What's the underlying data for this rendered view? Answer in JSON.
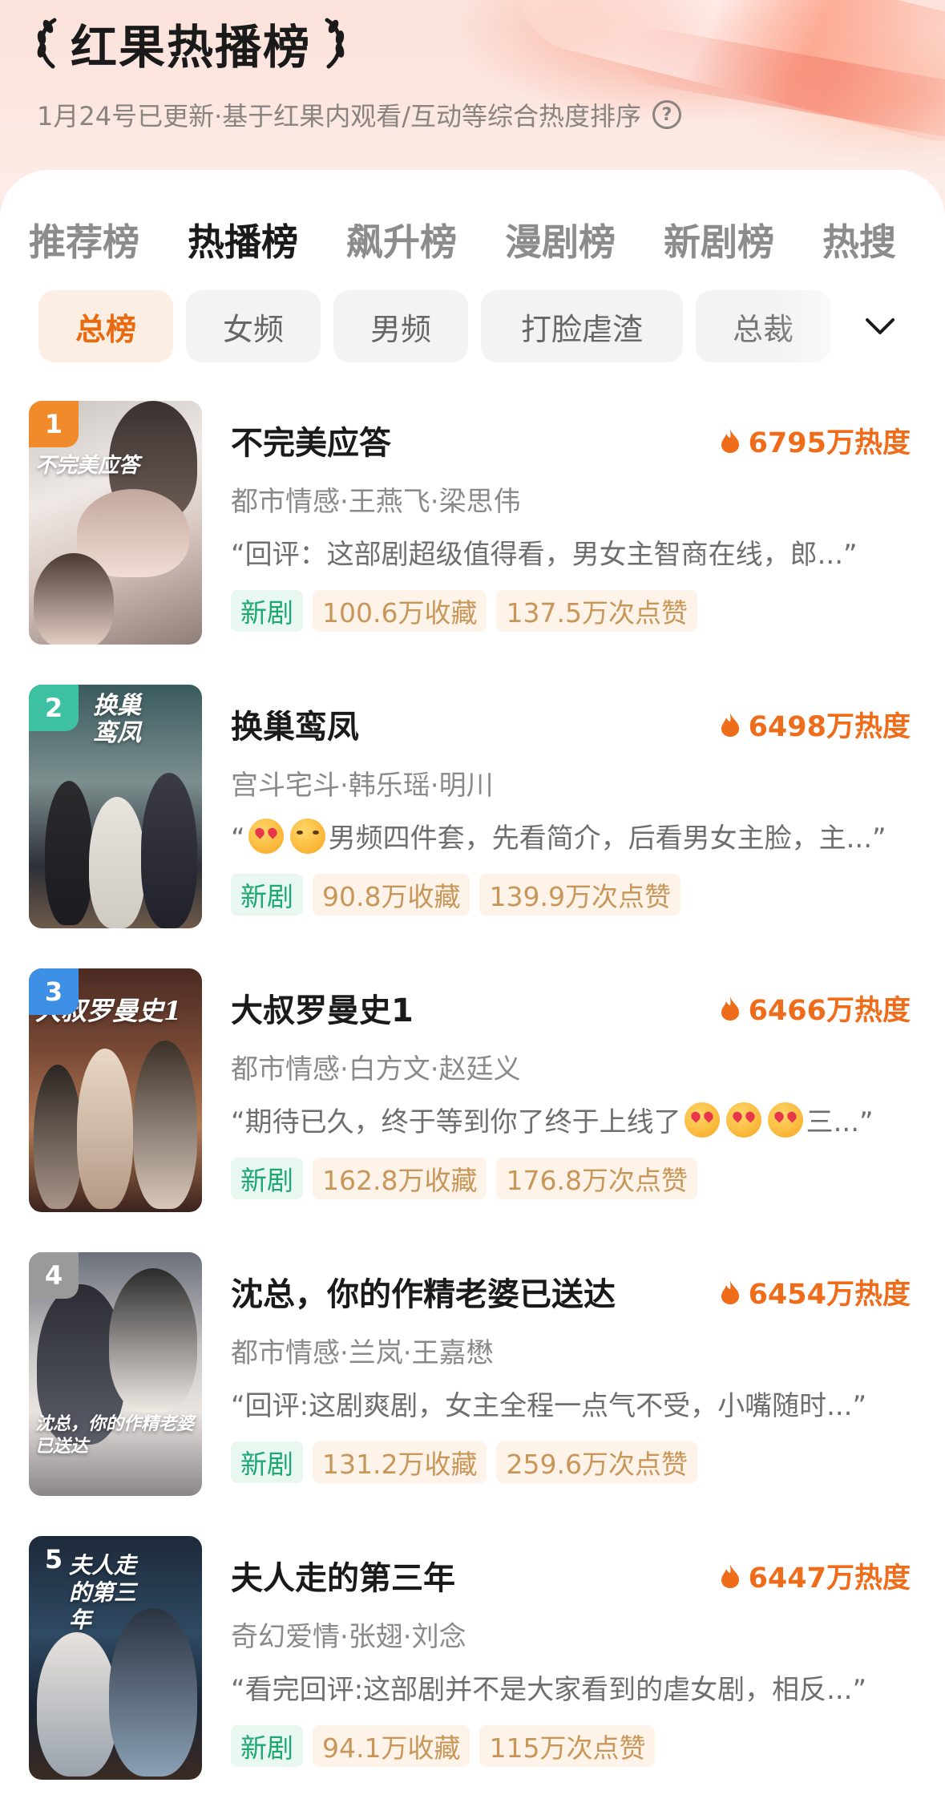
{
  "header": {
    "title": "红果热播榜",
    "subtitle": "1月24号已更新·基于红果内观看/互动等综合热度排序"
  },
  "tabs": [
    "推荐榜",
    "热播榜",
    "飙升榜",
    "漫剧榜",
    "新剧榜",
    "热搜"
  ],
  "active_tab": "热播榜",
  "chips": [
    "总榜",
    "女频",
    "男频",
    "打脸虐渣",
    "总裁"
  ],
  "active_chip": "总榜",
  "colors": {
    "accent": "#ef6c1a",
    "new_badge": "#1ea773",
    "rank_1": "#f08a2a",
    "rank_2": "#3ec1a3",
    "rank_3": "#3e8fe6",
    "rank_other": "#9a9a9a"
  },
  "items": [
    {
      "rank": "1",
      "title": "不完美应答",
      "heat": "6795万热度",
      "meta": "都市情感·王燕飞·梁思伟",
      "review": "“回评：这部剧超级值得看，男女主智商在线，郎...”",
      "tag": "新剧",
      "favorites": "100.6万收藏",
      "likes": "137.5万次点赞",
      "poster_text": "不完美应答"
    },
    {
      "rank": "2",
      "title": "换巢鸾凤",
      "heat": "6498万热度",
      "meta": "宫斗宅斗·韩乐瑶·明川",
      "review_text": "男频四件套，先看简介，后看男女主脸，主...”",
      "review_prefix": "“",
      "tag": "新剧",
      "favorites": "90.8万收藏",
      "likes": "139.9万次点赞",
      "poster_text": "换巢鸾凤"
    },
    {
      "rank": "3",
      "title": "大叔罗曼史1",
      "heat": "6466万热度",
      "meta": "都市情感·白方文·赵廷义",
      "review_text": "“期待已久，终于等到你了终于上线了",
      "review_suffix": "三...”",
      "tag": "新剧",
      "favorites": "162.8万收藏",
      "likes": "176.8万次点赞",
      "poster_text": "大叔罗曼史1"
    },
    {
      "rank": "4",
      "title": "沈总，你的作精老婆已送达",
      "heat": "6454万热度",
      "meta": "都市情感·兰岚·王嘉懋",
      "review": "“回评:这剧爽剧，女主全程一点气不受，小嘴随时...”",
      "tag": "新剧",
      "favorites": "131.2万收藏",
      "likes": "259.6万次点赞",
      "poster_text": "沈总，你的作精老婆已送达"
    },
    {
      "rank": "5",
      "title": "夫人走的第三年",
      "heat": "6447万热度",
      "meta": "奇幻爱情·张翅·刘念",
      "review": "“看完回评:这部剧并不是大家看到的虐女剧，相反...”",
      "tag": "新剧",
      "favorites": "94.1万收藏",
      "likes": "115万次点赞",
      "poster_text": "夫人走的第三年"
    }
  ]
}
